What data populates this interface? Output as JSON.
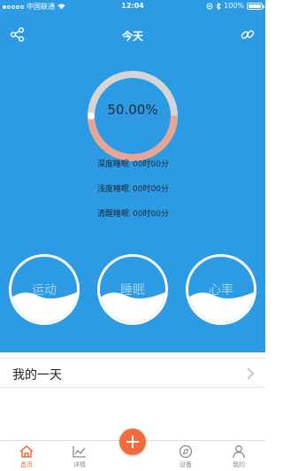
{
  "status_bar": {
    "carrier": "中国联通",
    "time": "12:04",
    "battery": "100%"
  },
  "header": {
    "title": "今天"
  },
  "sleep": {
    "progress_percent": 50,
    "progress_text": "50.00%",
    "stats": [
      {
        "label": "深度睡眠",
        "value": "00时00分"
      },
      {
        "label": "浅度睡眠",
        "value": "00时00分"
      },
      {
        "label": "清醒睡眠",
        "value": "00时00分"
      }
    ]
  },
  "metrics": [
    {
      "label": "运动"
    },
    {
      "label": "睡眠"
    },
    {
      "label": "心率"
    }
  ],
  "day_section": {
    "title": "我的一天"
  },
  "tabs": [
    {
      "label": "首页",
      "icon": "home-icon"
    },
    {
      "label": "详情",
      "icon": "chart-icon"
    },
    {
      "label": "设备",
      "icon": "compass-icon"
    },
    {
      "label": "我的",
      "icon": "user-icon"
    }
  ],
  "colors": {
    "primary": "#2c9be4",
    "accent": "#f26b3a",
    "ring_track": "#d5d5d5",
    "ring_progress": "#e9a493"
  }
}
